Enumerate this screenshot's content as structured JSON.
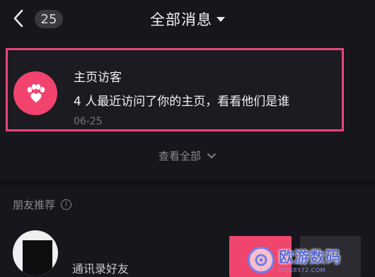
{
  "header": {
    "back_icon": "chevron-left-icon",
    "unread_count": "25",
    "title": "全部消息",
    "title_caret_icon": "caret-down-icon"
  },
  "visitor_card": {
    "icon": "paw-icon",
    "icon_color": "#f2436f",
    "highlight_color": "#e9457a",
    "title": "主页访客",
    "description": "4 人最近访问了你的主页，看看他们是谁",
    "date": "06-25"
  },
  "view_all": {
    "label": "查看全部",
    "icon": "chevron-down-icon"
  },
  "friends_section": {
    "title": "朋友推荐",
    "info_icon": "info-icon",
    "items": [
      {
        "subtitle": "通讯录好友",
        "follow_color": "#f0466d"
      }
    ]
  },
  "watermark": {
    "name": "欧游数码",
    "url": "OYJK8572.COM"
  }
}
